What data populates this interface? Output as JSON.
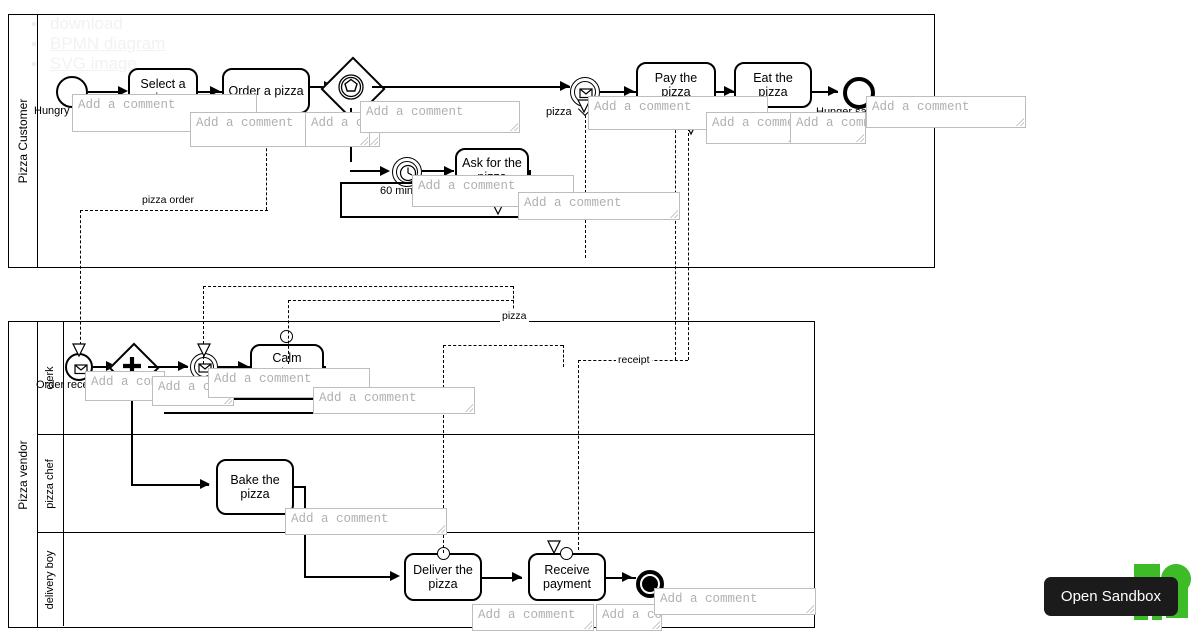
{
  "links": [
    {
      "label": "download",
      "linked": false
    },
    {
      "label": "BPMN diagram",
      "linked": true
    },
    {
      "label": "SVG image",
      "linked": true
    }
  ],
  "pools": [
    {
      "id": "customer",
      "label": "Pizza Customer",
      "lanes": []
    },
    {
      "id": "vendor",
      "label": "Pizza vendor",
      "lanes": [
        {
          "id": "clerk",
          "label": "clerk"
        },
        {
          "id": "chef",
          "label": "pizza chef"
        },
        {
          "id": "delivery",
          "label": "delivery boy"
        }
      ]
    }
  ],
  "events": {
    "hungry": {
      "label": "Hungry for pizza",
      "type": "start-event"
    },
    "pizza_received": {
      "label": "pizza",
      "type": "message-intermediate-event"
    },
    "timer_60": {
      "label": "60 min",
      "type": "timer-intermediate-event"
    },
    "hunger_satisfied": {
      "label": "Hunger satisfied",
      "type": "end-event"
    },
    "order_received": {
      "label": "Order received",
      "type": "message-start-event"
    },
    "clerk_msg": {
      "label": "",
      "type": "message-intermediate-event"
    },
    "vendor_end": {
      "label": "",
      "type": "terminate-end-event"
    }
  },
  "tasks": [
    {
      "id": "select-a-pizza",
      "label": "Select a pizza"
    },
    {
      "id": "order-a-pizza",
      "label": "Order a pizza"
    },
    {
      "id": "ask-for-the-pizza",
      "label": "Ask for the pizza"
    },
    {
      "id": "pay-the-pizza",
      "label": "Pay the pizza"
    },
    {
      "id": "eat-the-pizza",
      "label": "Eat the pizza"
    },
    {
      "id": "calm-customer",
      "label": "Calm customer"
    },
    {
      "id": "bake-the-pizza",
      "label": "Bake the pizza"
    },
    {
      "id": "deliver-the-pizza",
      "label": "Deliver the pizza"
    },
    {
      "id": "receive-payment",
      "label": "Receive payment"
    }
  ],
  "gateways": [
    {
      "id": "event-based-gateway",
      "type": "event-based-gateway"
    },
    {
      "id": "parallel-gateway",
      "type": "parallel-gateway"
    }
  ],
  "message_flows": [
    {
      "id": "pizza-order",
      "label": "pizza order"
    },
    {
      "id": "pizza",
      "label": "pizza"
    },
    {
      "id": "money",
      "label": "money"
    },
    {
      "id": "receipt",
      "label": "receipt"
    }
  ],
  "comment": {
    "placeholder": "Add a comment"
  },
  "sandbox": {
    "button_label": "Open Sandbox",
    "logo_color": "#3dbc27",
    "button_bg": "#1b1b1b"
  }
}
